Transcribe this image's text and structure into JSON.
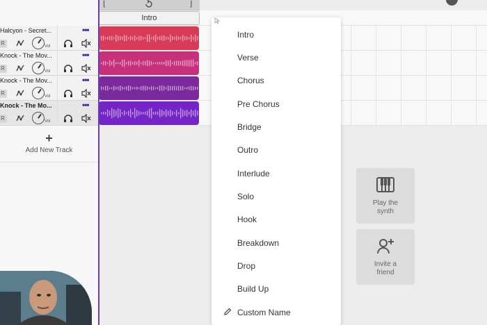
{
  "tracks": [
    {
      "name": "Halcyon - Secret...",
      "r_label": "R",
      "vol_label": "Vol",
      "color": "#d93a55"
    },
    {
      "name": "Knock - The Mov...",
      "r_label": "R",
      "vol_label": "Vol",
      "color": "#c7307a"
    },
    {
      "name": "Knock - The Mov...",
      "r_label": "R",
      "vol_label": "Vol",
      "color": "#7a2a9c"
    },
    {
      "name": "Knock - The Mo...",
      "r_label": "R",
      "vol_label": "Vol",
      "color": "#7525c7"
    }
  ],
  "add_track": {
    "label": "Add New Track"
  },
  "timeline": {
    "section_label": "Intro"
  },
  "dropdown": {
    "items": [
      "Intro",
      "Verse",
      "Chorus",
      "Pre Chorus",
      "Bridge",
      "Outro",
      "Interlude",
      "Solo",
      "Hook",
      "Breakdown",
      "Drop",
      "Build Up"
    ],
    "custom_label": "Custom Name"
  },
  "cards": {
    "synth": {
      "line1": "Play the",
      "line2": "synth"
    },
    "invite": {
      "line1": "Invite a",
      "line2": "friend"
    }
  },
  "icons": [
    "headphones-icon",
    "mute-icon",
    "effects-icon",
    "more-dots-icon",
    "loop-icon",
    "piano-icon",
    "add-person-icon",
    "pencil-icon",
    "plus-icon"
  ],
  "colors": {
    "playhead": "#6a3cb5",
    "dots": "#3b2fae"
  }
}
